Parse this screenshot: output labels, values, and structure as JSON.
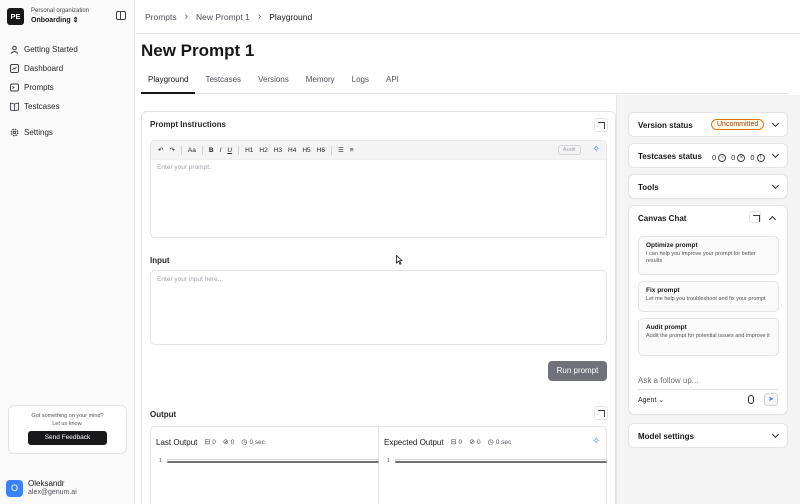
{
  "org": {
    "badge": "PE",
    "label": "Personal organization",
    "name": "Onboarding"
  },
  "nav": {
    "items": [
      {
        "label": "Getting Started",
        "icon": "user-icon"
      },
      {
        "label": "Dashboard",
        "icon": "dashboard-icon"
      },
      {
        "label": "Prompts",
        "icon": "prompts-icon"
      },
      {
        "label": "Testcases",
        "icon": "book-icon"
      },
      {
        "label": "Settings",
        "icon": "gear-icon"
      }
    ]
  },
  "feedback": {
    "line1": "Got something on your mind?",
    "line2": "Let us know.",
    "button": "Send Feedback"
  },
  "user": {
    "initial": "O",
    "name": "Oleksandr",
    "email": "alex@genum.ai"
  },
  "breadcrumb": {
    "items": [
      "Prompts",
      "New Prompt 1",
      "Playground"
    ]
  },
  "page": {
    "title": "New Prompt 1"
  },
  "tabs": [
    "Playground",
    "Testcases",
    "Versions",
    "Memory",
    "Logs",
    "API"
  ],
  "prompt_instructions": {
    "label": "Prompt Instructions",
    "toolbar": {
      "font_size": "Aa",
      "bold": "B",
      "italic": "I",
      "underline": "U",
      "headings": [
        "H1",
        "H2",
        "H3",
        "H4",
        "H5",
        "H6"
      ],
      "audit": "Audit"
    },
    "placeholder": "Enter your prompt.."
  },
  "input": {
    "label": "Input",
    "placeholder": "Enter your input here..."
  },
  "run_button": "Run prompt",
  "output": {
    "label": "Output",
    "last": {
      "title": "Last Output",
      "tokens": "0",
      "cost": "0",
      "time": "0 sec",
      "line": "1"
    },
    "expected": {
      "title": "Expected Output",
      "tokens": "0",
      "cost": "0",
      "time": "0 sec",
      "line": "1"
    }
  },
  "right": {
    "version_status": {
      "label": "Version status",
      "badge": "Uncommitted"
    },
    "testcases_status": {
      "label": "Testcases status",
      "counts": [
        "0",
        "0",
        "0"
      ]
    },
    "tools": {
      "label": "Tools"
    },
    "canvas_chat": {
      "label": "Canvas Chat",
      "suggestions": [
        {
          "title": "Optimize prompt",
          "desc": "I can help you improve your prompt for better results"
        },
        {
          "title": "Fix prompt",
          "desc": "Let me help you troubleshoot and fix your prompt"
        },
        {
          "title": "Audit prompt",
          "desc": "Audit the prompt for potential issues and improve it"
        }
      ],
      "follow_placeholder": "Ask a follow up...",
      "agent_label": "Agent"
    },
    "model_settings": {
      "label": "Model settings"
    }
  },
  "colors": {
    "accent": "#3b82f6",
    "badge_border": "#d97706",
    "run_button": "#71717a"
  }
}
